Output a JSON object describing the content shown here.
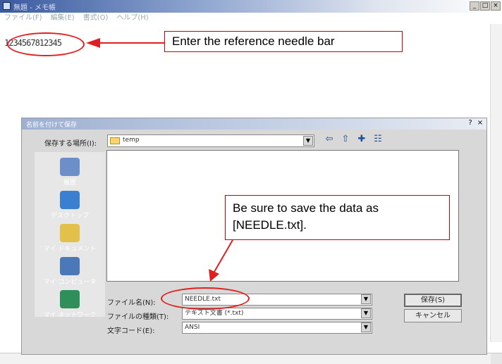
{
  "notepad": {
    "title": "無題 - メモ帳",
    "menu": [
      "ファイル(F)",
      "編集(E)",
      "書式(O)",
      "ヘルプ(H)"
    ],
    "text": "1234567812345",
    "controls": [
      "_",
      "□",
      "×"
    ]
  },
  "annotations": {
    "callout1": "Enter the reference needle bar",
    "callout2_line1": "Be sure to save the data as",
    "callout2_line2": "[NEEDLE.txt]."
  },
  "save_dialog": {
    "title": "名前を付けて保存",
    "title_buttons": [
      "?",
      "×"
    ],
    "save_in_label": "保存する場所(I):",
    "save_in_value": "temp",
    "places": [
      {
        "label": "履歴",
        "icon": "history-icon",
        "color": "#6d8fc9"
      },
      {
        "label": "デスクトップ",
        "icon": "desktop-icon",
        "color": "#3b7fd1"
      },
      {
        "label": "マイ ドキュメント",
        "icon": "my-documents-icon",
        "color": "#e3c04a"
      },
      {
        "label": "マイ コンピュータ",
        "icon": "my-computer-icon",
        "color": "#4a78b8"
      },
      {
        "label": "マイ ネットワーク",
        "icon": "my-network-icon",
        "color": "#2f8f5a"
      }
    ],
    "filename_label": "ファイル名(N):",
    "filename_value": "NEEDLE.txt",
    "filetype_label": "ファイルの種類(T):",
    "filetype_value": "テキスト文書 (*.txt)",
    "encoding_label": "文字コード(E):",
    "encoding_value": "ANSI",
    "save_button": "保存(S)",
    "cancel_button": "キャンセル"
  },
  "colors": {
    "annotation": "#e02020",
    "dialog_bg": "#d8d8d8"
  }
}
